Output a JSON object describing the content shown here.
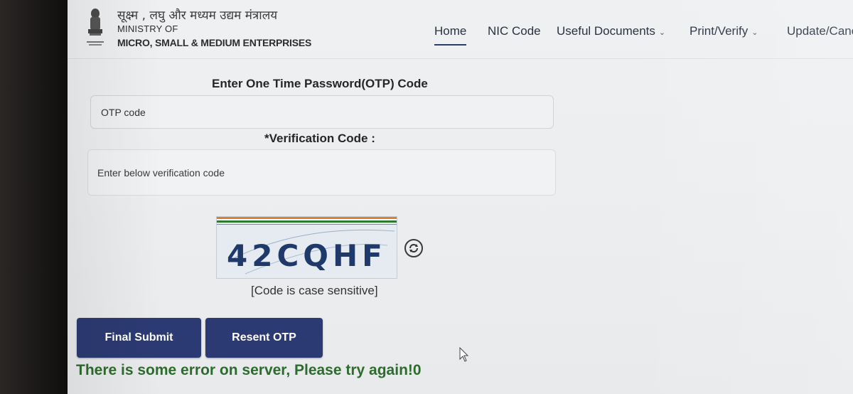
{
  "header": {
    "ministry_hindi": "सूक्ष्म , लघु और मध्यम उद्यम मंत्रालय",
    "ministry_line1": "MINISTRY OF",
    "ministry_line2": "MICRO, SMALL & MEDIUM ENTERPRISES",
    "emblem_icon": "national-emblem-icon"
  },
  "nav": {
    "items": [
      {
        "label": "Home",
        "active": true
      },
      {
        "label": "NIC Code"
      },
      {
        "label": "Useful Documents",
        "dropdown": true
      },
      {
        "label": "Print/Verify",
        "dropdown": true
      },
      {
        "label": "Update/Canc"
      }
    ],
    "accent": "#2a3d6e"
  },
  "form": {
    "otp_label": "Enter One Time Password(OTP) Code",
    "otp_placeholder": "OTP code",
    "verification_label": "*Verification Code :",
    "verification_placeholder": "Enter below verification code",
    "captcha_text": "42CQHF",
    "refresh_icon": "refresh-icon",
    "case_note": "[Code is case sensitive]"
  },
  "buttons": {
    "final_submit": "Final Submit",
    "resent_otp": "Resent OTP",
    "color": "#2c3a73"
  },
  "status": {
    "error": "There is some error on server, Please try again!0",
    "color": "#2e6b2e"
  }
}
